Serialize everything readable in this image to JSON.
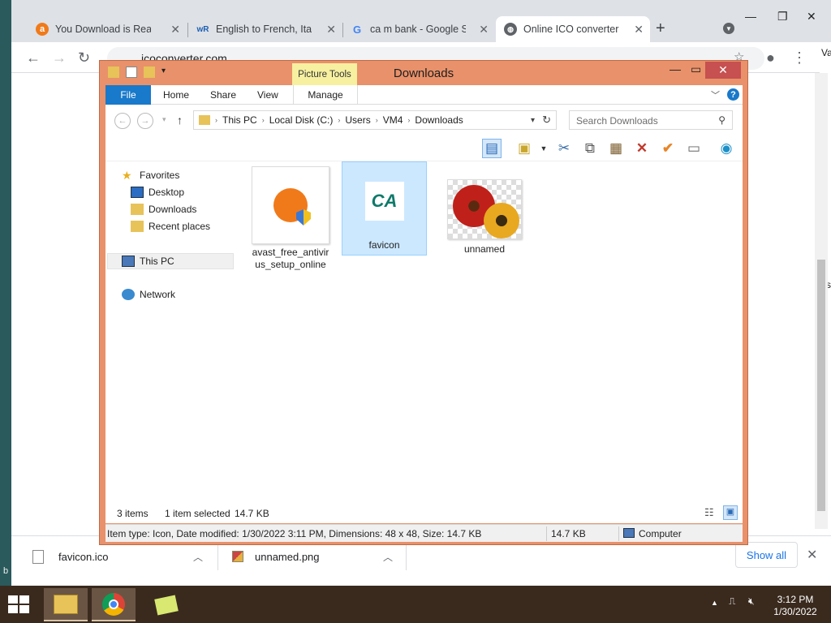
{
  "browser": {
    "tabs": [
      {
        "title": "You Download is Rea",
        "favicon": "avast-icon"
      },
      {
        "title": "English to French, Italia",
        "favicon": "wr-icon"
      },
      {
        "title": "ca m bank - Google Sea",
        "favicon": "google-icon"
      },
      {
        "title": "Online ICO converter",
        "favicon": "globe-icon"
      }
    ],
    "url": "icoconverter.com",
    "side_text_1": "Va",
    "side_text_2": "ss",
    "side_text_3": "b"
  },
  "downloads_bar": {
    "items": [
      {
        "name": "favicon.ico"
      },
      {
        "name": "unnamed.png"
      }
    ],
    "show_all": "Show all"
  },
  "explorer": {
    "title": "Downloads",
    "picture_tools": "Picture Tools",
    "ribbon_tabs": [
      "File",
      "Home",
      "Share",
      "View",
      "Manage"
    ],
    "breadcrumb": [
      "This PC",
      "Local Disk (C:)",
      "Users",
      "VM4",
      "Downloads"
    ],
    "search_placeholder": "Search Downloads",
    "nav": {
      "favorites": "Favorites",
      "desktop": "Desktop",
      "downloads": "Downloads",
      "recent": "Recent places",
      "this_pc": "This PC",
      "network": "Network"
    },
    "files": [
      {
        "name_line1": "avast_free_antivir",
        "name_line2": "us_setup_online",
        "selected": false
      },
      {
        "name_line1": "favicon",
        "name_line2": "",
        "selected": true
      },
      {
        "name_line1": "unnamed",
        "name_line2": "",
        "selected": false
      }
    ],
    "status": {
      "count": "3 items",
      "selected": "1 item selected",
      "size": "14.7 KB"
    },
    "details": {
      "info": "Item type: Icon, Date modified: 1/30/2022 3:11 PM, Dimensions: 48 x 48, Size: 14.7 KB",
      "size": "14.7 KB",
      "location": "Computer"
    },
    "colors": {
      "title_bar": "#e8916a",
      "file_tab": "#1979ca",
      "selection": "#cce8ff"
    }
  },
  "taskbar": {
    "time": "3:12 PM",
    "date": "1/30/2022"
  }
}
